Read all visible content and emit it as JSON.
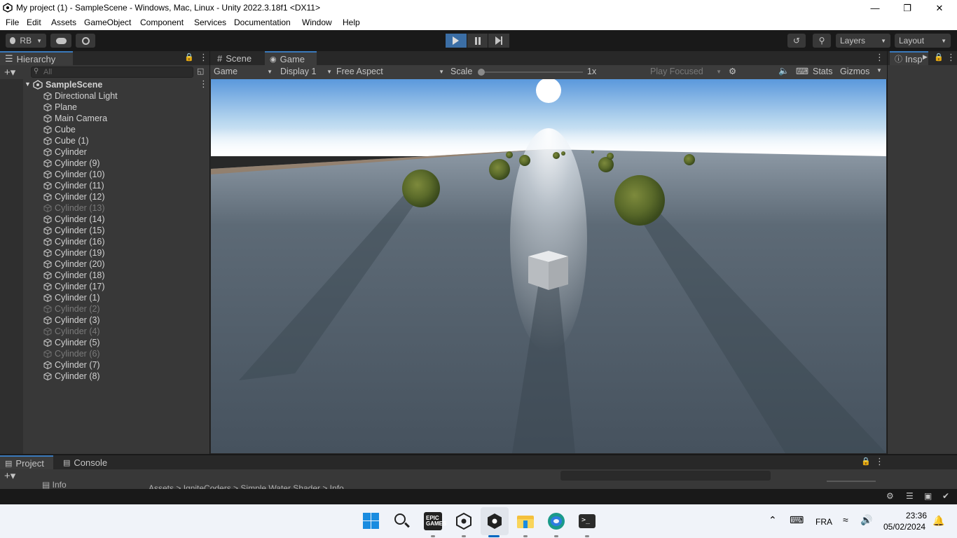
{
  "window": {
    "title": "My project (1) - SampleScene - Windows, Mac, Linux - Unity 2022.3.18f1 <DX11>",
    "minimize_icon": "minimize-icon",
    "maximize_icon": "restore-icon",
    "close_icon": "close-icon"
  },
  "menu": [
    "File",
    "Edit",
    "Assets",
    "GameObject",
    "Component",
    "Services",
    "Documentation",
    "Window",
    "Help"
  ],
  "toolbar": {
    "account": "RB",
    "layers": "Layers",
    "layout": "Layout"
  },
  "hierarchy": {
    "tab": "Hierarchy",
    "search_placeholder": "All",
    "scene": "SampleScene",
    "items": [
      {
        "label": "Directional Light",
        "active": true
      },
      {
        "label": "Plane",
        "active": true
      },
      {
        "label": "Main Camera",
        "active": true
      },
      {
        "label": "Cube",
        "active": true
      },
      {
        "label": "Cube (1)",
        "active": true
      },
      {
        "label": "Cylinder",
        "active": true
      },
      {
        "label": "Cylinder (9)",
        "active": true
      },
      {
        "label": "Cylinder (10)",
        "active": true
      },
      {
        "label": "Cylinder (11)",
        "active": true
      },
      {
        "label": "Cylinder (12)",
        "active": true
      },
      {
        "label": "Cylinder (13)",
        "active": false
      },
      {
        "label": "Cylinder (14)",
        "active": true
      },
      {
        "label": "Cylinder (15)",
        "active": true
      },
      {
        "label": "Cylinder (16)",
        "active": true
      },
      {
        "label": "Cylinder (19)",
        "active": true
      },
      {
        "label": "Cylinder (20)",
        "active": true
      },
      {
        "label": "Cylinder (18)",
        "active": true
      },
      {
        "label": "Cylinder (17)",
        "active": true
      },
      {
        "label": "Cylinder (1)",
        "active": true
      },
      {
        "label": "Cylinder (2)",
        "active": false
      },
      {
        "label": "Cylinder (3)",
        "active": true
      },
      {
        "label": "Cylinder (4)",
        "active": false
      },
      {
        "label": "Cylinder (5)",
        "active": true
      },
      {
        "label": "Cylinder (6)",
        "active": false
      },
      {
        "label": "Cylinder (7)",
        "active": true
      },
      {
        "label": "Cylinder (8)",
        "active": true
      }
    ]
  },
  "game": {
    "tabs": [
      "Scene",
      "Game"
    ],
    "mode": "Game",
    "display": "Display 1",
    "aspect": "Free Aspect",
    "scale_label": "Scale",
    "scale_value": "1x",
    "play_mode": "Play Focused",
    "stats": "Stats",
    "gizmos": "Gizmos"
  },
  "inspector": {
    "tab": "Insp"
  },
  "project": {
    "tabs": [
      "Project",
      "Console"
    ],
    "folder": "Info",
    "breadcrumb": "Assets > IgniteCoders > Simple Water Shader > Info"
  },
  "taskbar": {
    "lang": "FRA",
    "time": "23:36",
    "date": "05/02/2024"
  }
}
